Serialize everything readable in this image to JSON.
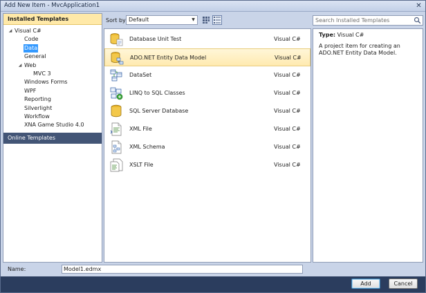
{
  "window": {
    "title": "Add New Item - MvcApplication1",
    "close_glyph": "✕"
  },
  "left": {
    "installed_header": "Installed Templates",
    "tree": [
      {
        "label": "Visual C#",
        "depth": 0,
        "expanded": true
      },
      {
        "label": "Code",
        "depth": 1
      },
      {
        "label": "Data",
        "depth": 1,
        "selected": true
      },
      {
        "label": "General",
        "depth": 1
      },
      {
        "label": "Web",
        "depth": 1,
        "expanded": true
      },
      {
        "label": "MVC 3",
        "depth": 2
      },
      {
        "label": "Windows Forms",
        "depth": 1
      },
      {
        "label": "WPF",
        "depth": 1
      },
      {
        "label": "Reporting",
        "depth": 1
      },
      {
        "label": "Silverlight",
        "depth": 1
      },
      {
        "label": "Workflow",
        "depth": 1
      },
      {
        "label": "XNA Game Studio 4.0",
        "depth": 1
      }
    ],
    "online_templates": "Online Templates"
  },
  "toolbar": {
    "sort_label": "Sort by:",
    "sort_value": "Default"
  },
  "items": [
    {
      "name": "Database Unit Test",
      "lang": "Visual C#",
      "icon": "database-unit-test-icon"
    },
    {
      "name": "ADO.NET Entity Data Model",
      "lang": "Visual C#",
      "icon": "entity-data-model-icon",
      "selected": true
    },
    {
      "name": "DataSet",
      "lang": "Visual C#",
      "icon": "dataset-icon"
    },
    {
      "name": "LINQ to SQL Classes",
      "lang": "Visual C#",
      "icon": "linq-to-sql-icon"
    },
    {
      "name": "SQL Server Database",
      "lang": "Visual C#",
      "icon": "sql-database-icon"
    },
    {
      "name": "XML File",
      "lang": "Visual C#",
      "icon": "xml-file-icon"
    },
    {
      "name": "XML Schema",
      "lang": "Visual C#",
      "icon": "xml-schema-icon"
    },
    {
      "name": "XSLT File",
      "lang": "Visual C#",
      "icon": "xslt-file-icon"
    }
  ],
  "right": {
    "search_placeholder": "Search Installed Templates",
    "type_label": "Type:",
    "type_value": "Visual C#",
    "description": "A project item for creating an ADO.NET Entity Data Model."
  },
  "bottom": {
    "name_label": "Name:",
    "name_value": "Model1.edmx",
    "add_label": "Add",
    "cancel_label": "Cancel"
  },
  "colors": {
    "selection_blue": "#3399ff",
    "highlight_gold": "#ffe9a8",
    "frame_dark": "#2b3d5e"
  }
}
